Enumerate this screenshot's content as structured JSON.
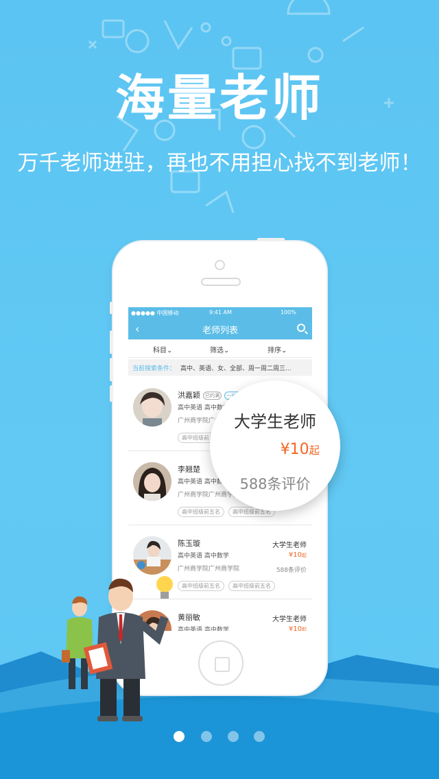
{
  "headline": "海量老师",
  "subline": "万千老师进驻，再也不用担心找不到老师！",
  "status_bar": {
    "carrier": "●●●●● 中国移动",
    "time": "9:41 AM",
    "battery": "100%"
  },
  "nav": {
    "title": "老师列表"
  },
  "filters": {
    "subject": "科目",
    "screen": "筛选",
    "sort": "排序"
  },
  "conditions": {
    "label": "当前搜索条件：",
    "value": "高中、英语、女、全部、周一周二周三..."
  },
  "teachers": [
    {
      "name": "洪嘉颖",
      "badge1": "已约满",
      "badge2": "一对一",
      "subjects": "高中英语  高中数学",
      "school": "广州商学院广州商学院",
      "tag1": "高中班级前五名",
      "tag2": "",
      "type": "",
      "price": "",
      "price_unit": "",
      "reviews": ""
    },
    {
      "name": "李翘楚",
      "badge1": "",
      "badge2": "",
      "subjects": "高中英语  高中数学",
      "school": "广州商学院广州商学院",
      "tag1": "高中班级前五名",
      "tag2": "高中班级前五名",
      "type": "",
      "price": "",
      "price_unit": "",
      "reviews": ""
    },
    {
      "name": "陈玉璇",
      "badge1": "",
      "badge2": "",
      "subjects": "高中英语  高中数学",
      "school": "广州商学院广州商学院",
      "tag1": "高中班级前五名",
      "tag2": "高中班级前五名",
      "type": "大学生老师",
      "price": "¥10",
      "price_unit": "起",
      "reviews": "588条评价"
    },
    {
      "name": "黄丽敏",
      "badge1": "",
      "badge2": "",
      "subjects": "高中英语  高中数学",
      "school": "",
      "tag1": "",
      "tag2": "",
      "type": "大学生老师",
      "price": "¥10",
      "price_unit": "起",
      "reviews": ""
    }
  ],
  "popup": {
    "type": "大学生老师",
    "price": "¥10",
    "price_unit": "起",
    "reviews": "588条评价"
  },
  "pager": {
    "count": 4,
    "active": 0
  },
  "colors": {
    "background": "#5cc4f2",
    "nav": "#5bbde7",
    "price": "#f26522",
    "hills_dark": "#1f8ccf",
    "hills_light": "#39a7e0"
  }
}
